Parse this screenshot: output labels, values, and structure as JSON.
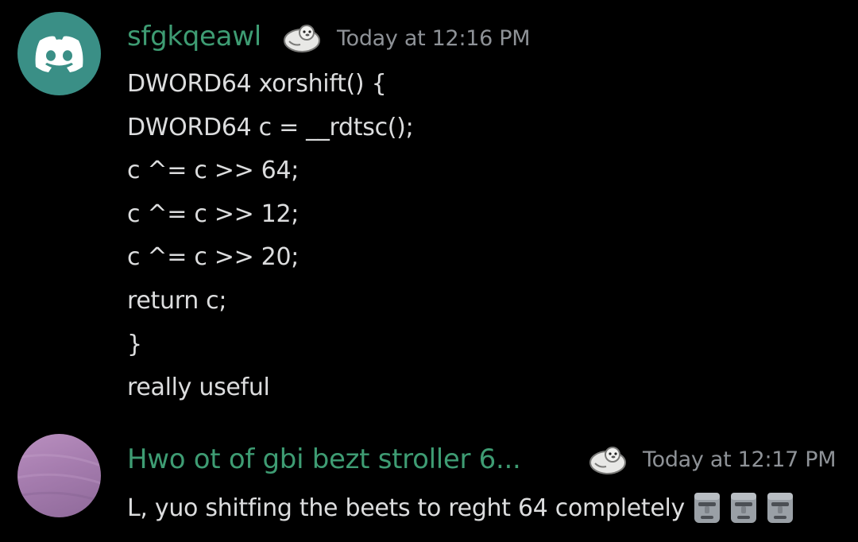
{
  "messages": [
    {
      "username": "sfgkqeawl",
      "timestamp": "Today at 12:16 PM",
      "avatar_icon": "discord-logo-icon",
      "badge_icon": "seal-emoji-icon",
      "lines": [
        "DWORD64 xorshift() {",
        "DWORD64 c = __rdtsc();",
        "c ^= c >> 64;",
        "c ^= c >> 12;",
        "c ^= c >> 20;",
        "return c;",
        "}",
        "really useful"
      ]
    },
    {
      "username": "Hwo ot of gbi bezt stroller 6...",
      "timestamp": "Today at 12:17 PM",
      "avatar_icon": "purple-avatar",
      "badge_icon": "seal-emoji-icon",
      "text": "L, yuo shitfing the beets to reght 64 completely",
      "emojis": [
        "moai-emoji-icon",
        "moai-emoji-icon",
        "moai-emoji-icon"
      ]
    }
  ],
  "colors": {
    "background": "#000000",
    "username": "#3e9c73",
    "timestamp": "#8e9297",
    "text": "#dcddde",
    "discord_avatar": "#3a8f86",
    "purple_avatar": "#a57cae"
  }
}
